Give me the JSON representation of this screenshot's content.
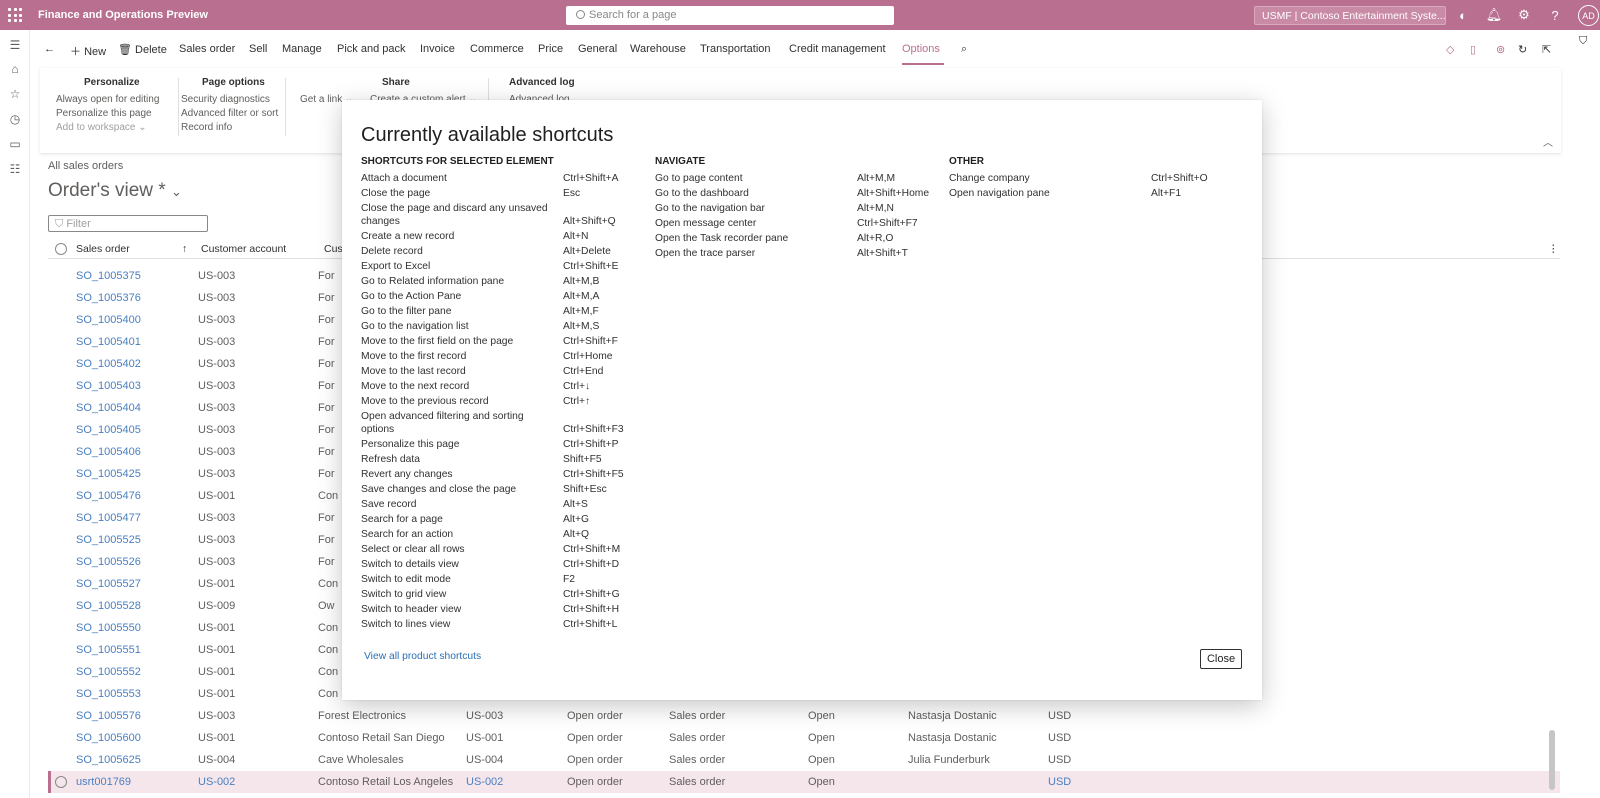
{
  "topbar": {
    "app_title": "Finance and Operations Preview",
    "search_placeholder": "Search for a page",
    "company": "USMF | Contoso Entertainment Syste...",
    "user_initials": "AD",
    "color": "#b96f8f"
  },
  "actionpane": {
    "tabs": [
      "Sales order",
      "Sell",
      "Manage",
      "Pick and pack",
      "Invoice",
      "Commerce",
      "Price",
      "General",
      "Warehouse",
      "Transportation",
      "Credit management",
      "Options"
    ],
    "new_label": "New",
    "delete_label": "Delete",
    "active_tab": "Options"
  },
  "ribbon": {
    "personalize": {
      "title": "Personalize",
      "items": [
        "Always open for editing",
        "Personalize this page",
        "Add to workspace"
      ]
    },
    "page_options": {
      "title": "Page options",
      "items": [
        "Security diagnostics",
        "Advanced filter or sort",
        "Record info"
      ]
    },
    "share": {
      "title": "Share",
      "items": [
        "Get a link",
        "Create a custom alert"
      ]
    },
    "advanced_log": {
      "title": "Advanced log",
      "items": [
        "Advanced log"
      ]
    }
  },
  "page": {
    "breadcrumb": "All sales orders",
    "view_title": "Order's view *",
    "filter_placeholder": "Filter",
    "columns": [
      "Sales order",
      "Customer account",
      "Cus"
    ]
  },
  "grid_rows": [
    {
      "so": "SO_1005375",
      "acct": "US-003",
      "name": "For"
    },
    {
      "so": "SO_1005376",
      "acct": "US-003",
      "name": "For"
    },
    {
      "so": "SO_1005400",
      "acct": "US-003",
      "name": "For"
    },
    {
      "so": "SO_1005401",
      "acct": "US-003",
      "name": "For"
    },
    {
      "so": "SO_1005402",
      "acct": "US-003",
      "name": "For"
    },
    {
      "so": "SO_1005403",
      "acct": "US-003",
      "name": "For"
    },
    {
      "so": "SO_1005404",
      "acct": "US-003",
      "name": "For"
    },
    {
      "so": "SO_1005405",
      "acct": "US-003",
      "name": "For"
    },
    {
      "so": "SO_1005406",
      "acct": "US-003",
      "name": "For"
    },
    {
      "so": "SO_1005425",
      "acct": "US-003",
      "name": "For"
    },
    {
      "so": "SO_1005476",
      "acct": "US-001",
      "name": "Con"
    },
    {
      "so": "SO_1005477",
      "acct": "US-003",
      "name": "For"
    },
    {
      "so": "SO_1005525",
      "acct": "US-003",
      "name": "For"
    },
    {
      "so": "SO_1005526",
      "acct": "US-003",
      "name": "For"
    },
    {
      "so": "SO_1005527",
      "acct": "US-001",
      "name": "Con"
    },
    {
      "so": "SO_1005528",
      "acct": "US-009",
      "name": "Ow"
    },
    {
      "so": "SO_1005550",
      "acct": "US-001",
      "name": "Con"
    },
    {
      "so": "SO_1005551",
      "acct": "US-001",
      "name": "Con"
    },
    {
      "so": "SO_1005552",
      "acct": "US-001",
      "name": "Con"
    },
    {
      "so": "SO_1005553",
      "acct": "US-001",
      "name": "Con"
    },
    {
      "so": "SO_1005576",
      "acct": "US-003",
      "name": "Forest Electronics",
      "invacct": "US-003",
      "status": "Open order",
      "type": "Sales order",
      "rel": "Open",
      "resp": "Nastasja Dostanic",
      "cur": "USD"
    },
    {
      "so": "SO_1005600",
      "acct": "US-001",
      "name": "Contoso Retail San Diego",
      "invacct": "US-001",
      "status": "Open order",
      "type": "Sales order",
      "rel": "Open",
      "resp": "Nastasja Dostanic",
      "cur": "USD"
    },
    {
      "so": "SO_1005625",
      "acct": "US-004",
      "name": "Cave Wholesales",
      "invacct": "US-004",
      "status": "Open order",
      "type": "Sales order",
      "rel": "Open",
      "resp": "Julia Funderburk",
      "cur": "USD"
    },
    {
      "so": "usrt001769",
      "acct": "US-002",
      "name": "Contoso Retail Los Angeles",
      "invacct": "US-002",
      "status": "Open order",
      "type": "Sales order",
      "rel": "Open",
      "resp": "",
      "cur": "USD",
      "selected": true
    }
  ],
  "dialog": {
    "title": "Currently available shortcuts",
    "selected_element": {
      "heading": "SHORTCUTS FOR SELECTED ELEMENT",
      "items": [
        {
          "name": "Attach a document",
          "keys": "Ctrl+Shift+A"
        },
        {
          "name": "Close the page",
          "keys": "Esc"
        },
        {
          "name": "Close the page and discard any unsaved changes",
          "keys": "Alt+Shift+Q"
        },
        {
          "name": "Create a new record",
          "keys": "Alt+N"
        },
        {
          "name": "Delete record",
          "keys": "Alt+Delete"
        },
        {
          "name": "Export to Excel",
          "keys": "Ctrl+Shift+E"
        },
        {
          "name": "Go to Related information pane",
          "keys": "Alt+M,B"
        },
        {
          "name": "Go to the Action Pane",
          "keys": "Alt+M,A"
        },
        {
          "name": "Go to the filter pane",
          "keys": "Alt+M,F"
        },
        {
          "name": "Go to the navigation list",
          "keys": "Alt+M,S"
        },
        {
          "name": "Move to the first field on the page",
          "keys": "Ctrl+Shift+F"
        },
        {
          "name": "Move to the first record",
          "keys": "Ctrl+Home"
        },
        {
          "name": "Move to the last record",
          "keys": "Ctrl+End"
        },
        {
          "name": "Move to the next record",
          "keys": "Ctrl+↓"
        },
        {
          "name": "Move to the previous record",
          "keys": "Ctrl+↑"
        },
        {
          "name": "Open advanced filtering and sorting options",
          "keys": "Ctrl+Shift+F3"
        },
        {
          "name": "Personalize this page",
          "keys": "Ctrl+Shift+P"
        },
        {
          "name": "Refresh data",
          "keys": "Shift+F5"
        },
        {
          "name": "Revert any changes",
          "keys": "Ctrl+Shift+F5"
        },
        {
          "name": "Save changes and close the page",
          "keys": "Shift+Esc"
        },
        {
          "name": "Save record",
          "keys": "Alt+S"
        },
        {
          "name": "Search for a page",
          "keys": "Alt+G"
        },
        {
          "name": "Search for an action",
          "keys": "Alt+Q"
        },
        {
          "name": "Select or clear all rows",
          "keys": "Ctrl+Shift+M"
        },
        {
          "name": "Switch to details view",
          "keys": "Ctrl+Shift+D"
        },
        {
          "name": "Switch to edit mode",
          "keys": "F2"
        },
        {
          "name": "Switch to grid view",
          "keys": "Ctrl+Shift+G"
        },
        {
          "name": "Switch to header view",
          "keys": "Ctrl+Shift+H"
        },
        {
          "name": "Switch to lines view",
          "keys": "Ctrl+Shift+L"
        }
      ]
    },
    "navigate": {
      "heading": "NAVIGATE",
      "items": [
        {
          "name": "Go to page content",
          "keys": "Alt+M,M"
        },
        {
          "name": "Go to the dashboard",
          "keys": "Alt+Shift+Home"
        },
        {
          "name": "Go to the navigation bar",
          "keys": "Alt+M,N"
        },
        {
          "name": "Open message center",
          "keys": "Ctrl+Shift+F7"
        },
        {
          "name": "Open the Task recorder pane",
          "keys": "Alt+R,O"
        },
        {
          "name": "Open the trace parser",
          "keys": "Alt+Shift+T"
        }
      ]
    },
    "other": {
      "heading": "OTHER",
      "items": [
        {
          "name": "Change company",
          "keys": "Ctrl+Shift+O"
        },
        {
          "name": "Open navigation pane",
          "keys": "Alt+F1"
        }
      ]
    },
    "view_all_label": "View all product shortcuts",
    "close_label": "Close"
  }
}
